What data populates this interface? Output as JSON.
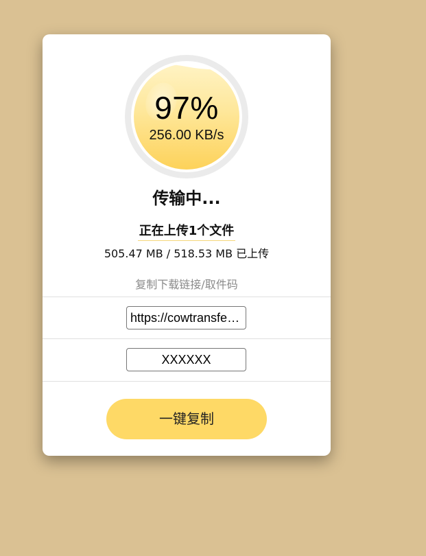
{
  "progress": {
    "percent_label": "97%",
    "value": 0.97,
    "speed": "256.00 KB/s"
  },
  "status": {
    "title": "传输中...",
    "subtitle": "正在上传1个文件",
    "size_progress": "505.47 MB / 518.53 MB 已上传"
  },
  "share": {
    "label": "复制下载链接/取件码",
    "link_value": "https://cowtransfer.com/s/",
    "code_value": "XXXXXX"
  },
  "actions": {
    "copy_all": "一键复制"
  },
  "colors": {
    "background": "#dac193",
    "accent": "#fed966",
    "liquid_top": "#fff0b8",
    "liquid_bottom": "#fdd661"
  }
}
